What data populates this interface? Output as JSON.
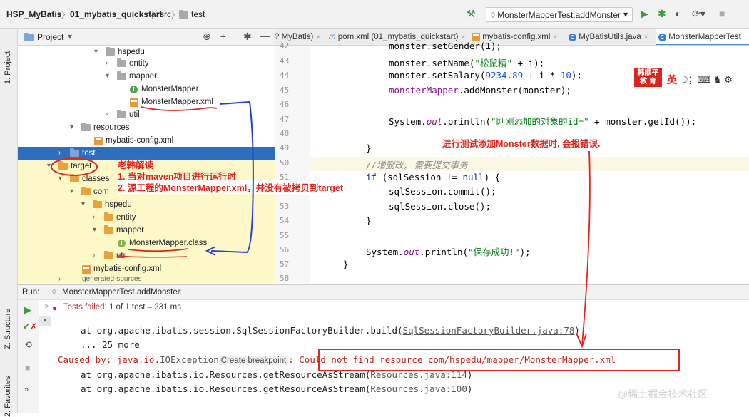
{
  "navbar": {
    "project": "HSP_MyBatis",
    "module": "01_mybatis_quickstart",
    "src": "src",
    "test": "test",
    "run_config": "MonsterMapperTest.addMonster"
  },
  "sidebar": {
    "project_tab": "1: Project",
    "structure_tab": "Z: Structure",
    "favorites_tab": "2: Favorites"
  },
  "project_panel": {
    "title": "Project",
    "tree": [
      {
        "label": "hspedu"
      },
      {
        "label": "entity"
      },
      {
        "label": "mapper"
      },
      {
        "label": "MonsterMapper"
      },
      {
        "label": "MonsterMapper.xml"
      },
      {
        "label": "util"
      },
      {
        "label": "resources"
      },
      {
        "label": "mybatis-config.xml"
      },
      {
        "label": "test"
      },
      {
        "label": "target"
      },
      {
        "label": "classes"
      },
      {
        "label": "com"
      },
      {
        "label": "hspedu"
      },
      {
        "label": "entity"
      },
      {
        "label": "mapper"
      },
      {
        "label": "MonsterMapper.class"
      },
      {
        "label": "util"
      },
      {
        "label": "mybatis-config.xml"
      },
      {
        "label": "generated-sources"
      }
    ]
  },
  "editor_tabs": [
    {
      "label": "? MyBatis)"
    },
    {
      "label": "pom.xml (01_mybatis_quickstart)"
    },
    {
      "label": "mybatis-config.xml"
    },
    {
      "label": "MyBatisUtils.java"
    },
    {
      "label": "MonsterMapperTest"
    }
  ],
  "editor": {
    "line_numbers": [
      "42",
      "43",
      "44",
      "45",
      "46",
      "47",
      "48",
      "49",
      "50",
      "51",
      "52",
      "53",
      "54",
      "55",
      "56",
      "57",
      "58"
    ],
    "lines": {
      "l42": "monster.setGender(1);",
      "l43_a": "monster.setName(",
      "l43_s": "\"松鼠精\"",
      "l43_b": " + i);",
      "l44_a": "monster.setSalary(",
      "l44_n": "9234.89",
      "l44_b": " + i * ",
      "l44_n2": "10",
      "l44_c": ");",
      "l45_f": "monsterMapper",
      "l45_b": ".addMonster(monster);",
      "l47_a": "System.",
      "l47_f": "out",
      "l47_b": ".println(",
      "l47_s": "\"刚刚添加的对象的id=\"",
      "l47_c": " + monster.getId());",
      "l49": "}",
      "l50": "//增删改, 需要提交事务",
      "l51_k": "if",
      "l51_a": " (sqlSession != ",
      "l51_k2": "null",
      "l51_b": ") {",
      "l52": "sqlSession.commit();",
      "l53": "sqlSession.close();",
      "l54": "}",
      "l56_a": "System.",
      "l56_f": "out",
      "l56_b": ".println(",
      "l56_s": "\"保存成功!\"",
      "l56_c": ");",
      "l57": "}"
    }
  },
  "run_panel": {
    "label": "Run:",
    "tab": "MonsterMapperTest.addMonster",
    "status_bold": "Tests failed:",
    "status_rest": "1 of 1 test – 231 ms",
    "console": {
      "c1_a": "at org.apache.ibatis.session.SqlSessionFactoryBuilder.build(",
      "c1_link": "SqlSessionFactoryBuilder.java:78",
      "c1_b": ")",
      "c2": "... 25 more",
      "c3_a": "Caused by: java.io.",
      "c3_link": "IOException",
      "c3_hint": "Create breakpoint",
      "c3_b": ": Could not find resource com/hspedu/mapper/MonsterMapper.xml",
      "c4_a": "at org.apache.ibatis.io.Resources.getResourceAsStream(",
      "c4_link": "Resources.java:114",
      "c4_b": ")",
      "c5_a": "at org.apache.ibatis.io.Resources.getResourceAsStream(",
      "c5_link": "Resources.java:100",
      "c5_b": ")"
    }
  },
  "annotations": {
    "teacher_title": "老韩解读",
    "note1": "1. 当对maven项目进行运行时",
    "note2": "2. 源工程的MonsterMapper.xml，并没有被拷贝到target",
    "error_note": "进行测试添加Monster数据时, 会报错误.",
    "badge_top": "韩顺平",
    "badge_bottom": "教 育",
    "ime": "英",
    "watermark": "@稀土掘金技术社区"
  },
  "colors": {
    "selection": "#2e6fbd",
    "highlight_row": "#fcf8c8",
    "annotation_red": "#e0261d",
    "arrow_blue": "#2a3fd1"
  }
}
